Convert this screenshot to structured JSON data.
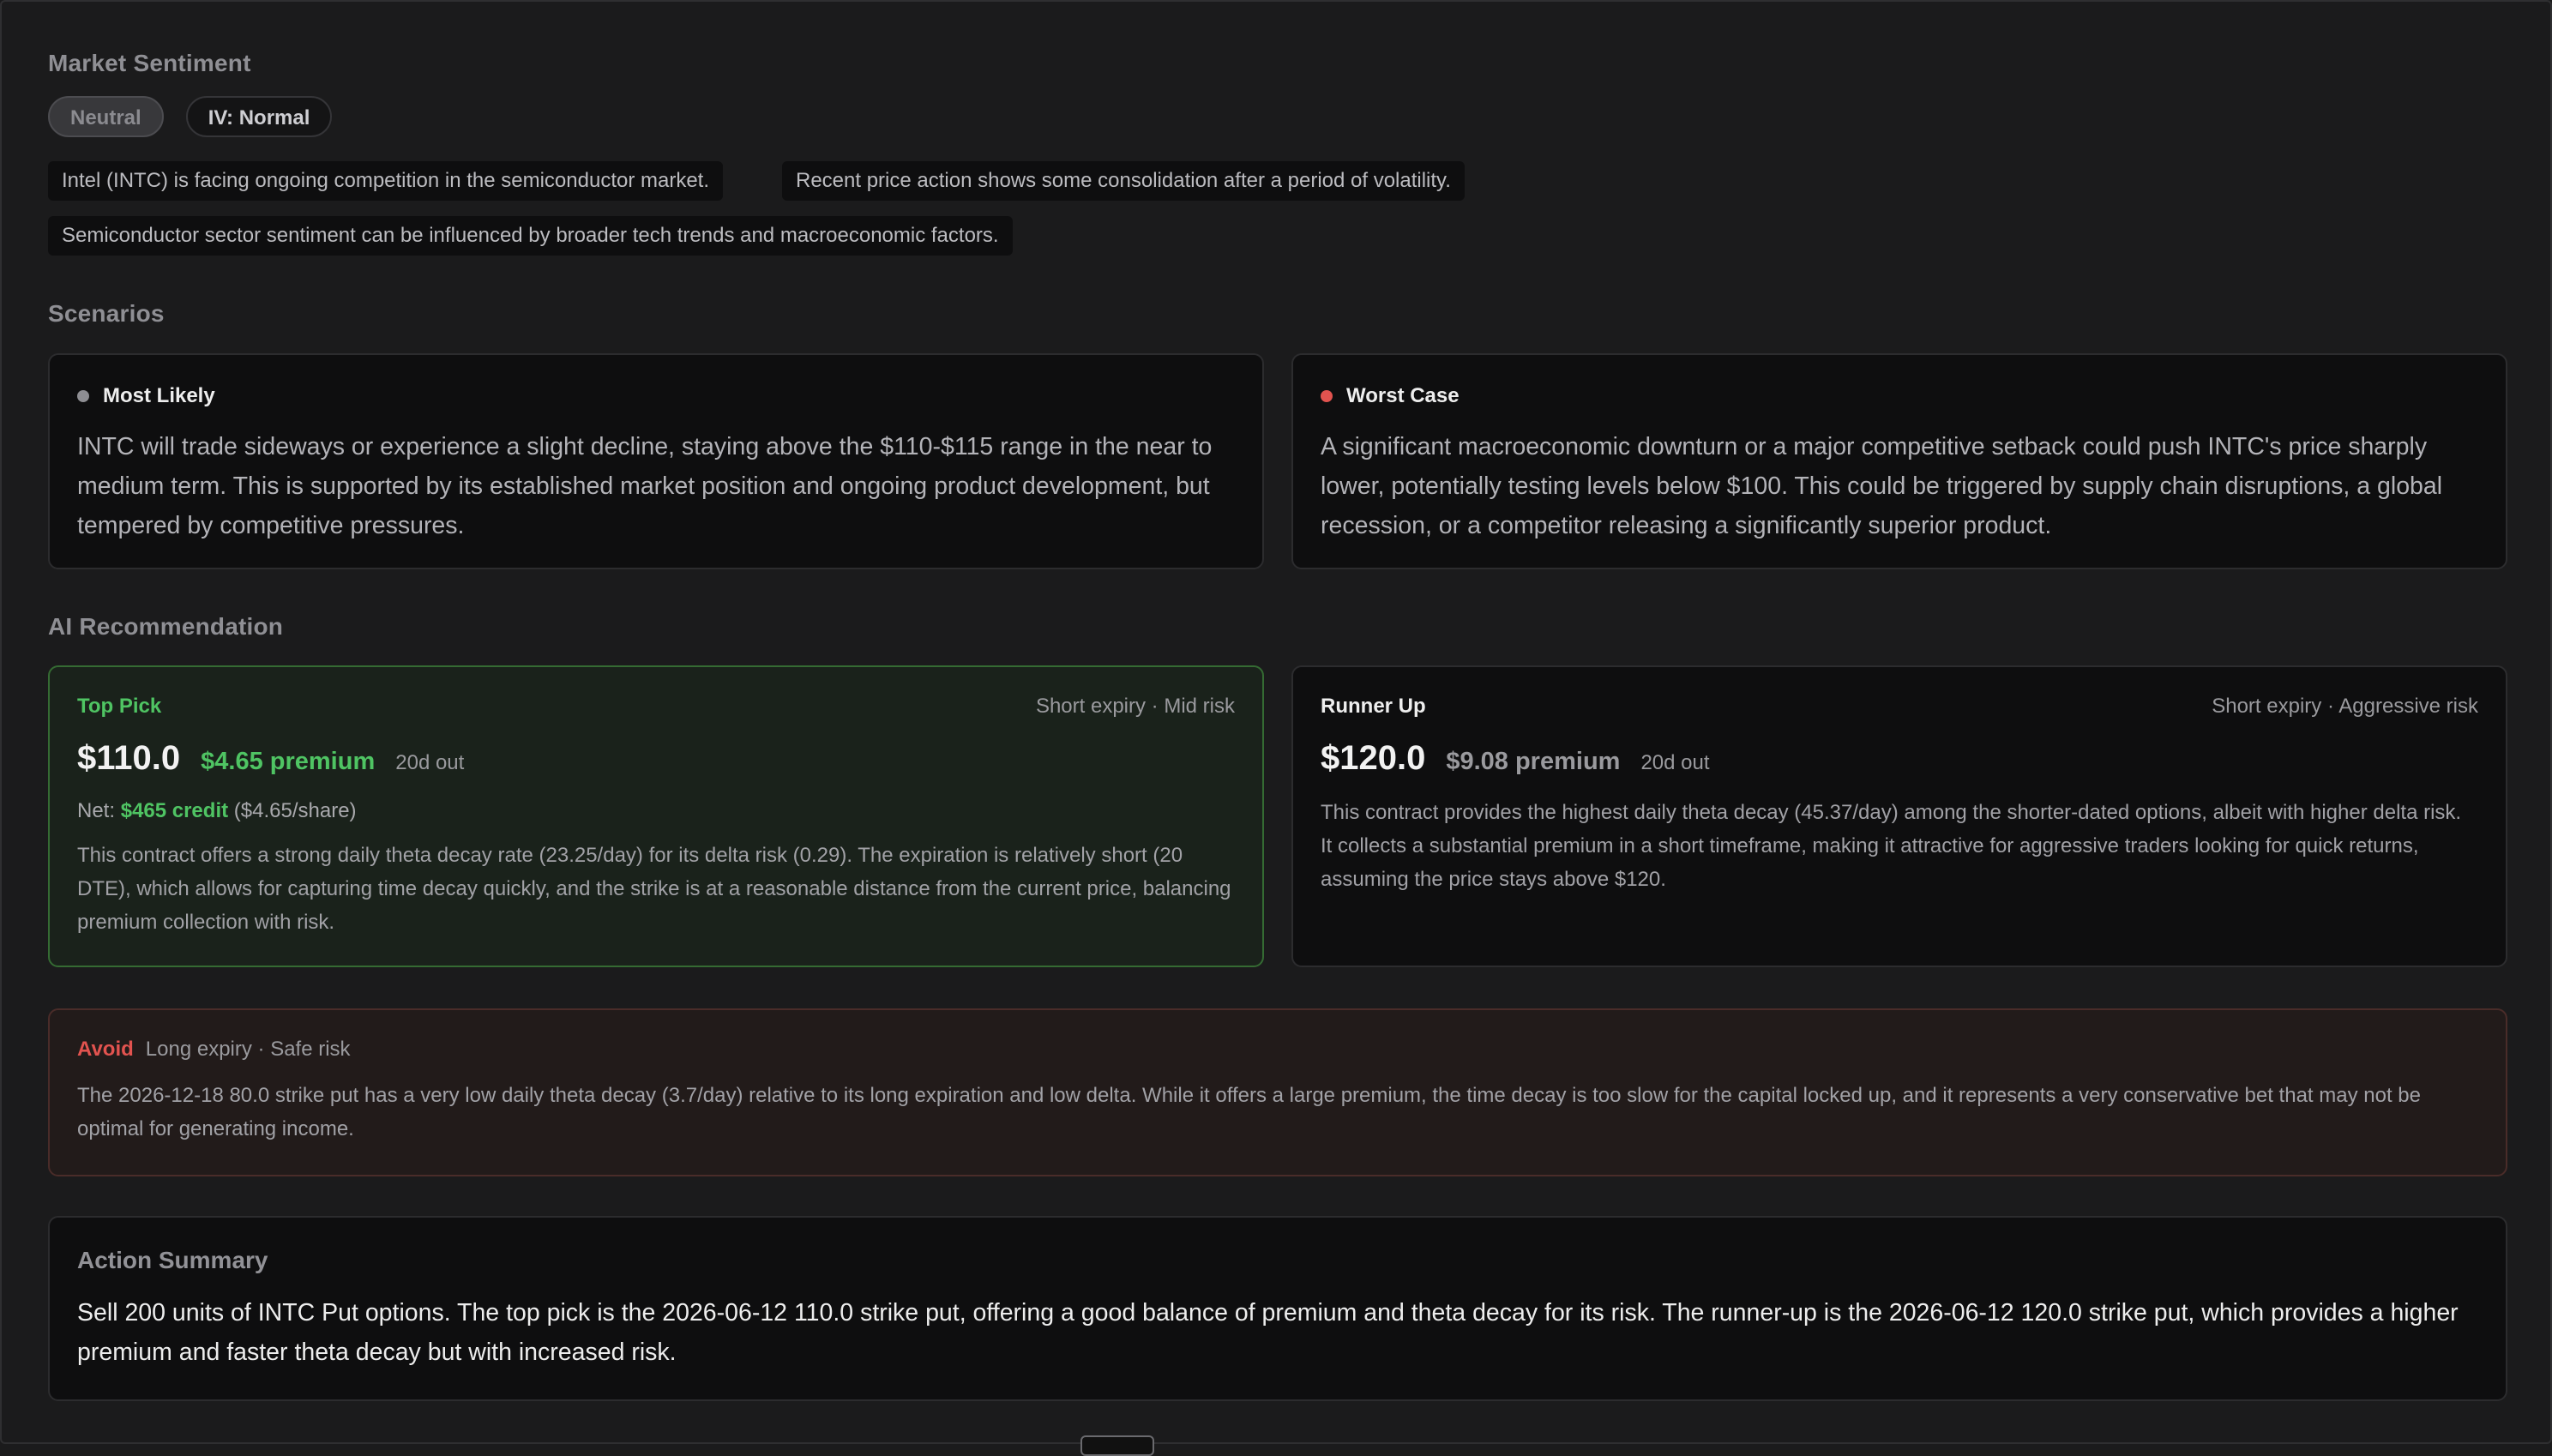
{
  "sentiment": {
    "title": "Market Sentiment",
    "badges": [
      "Neutral",
      "IV: Normal"
    ],
    "notes": [
      "Intel (INTC) is facing ongoing competition in the semiconductor market.",
      "Recent price action shows some consolidation after a period of volatility.",
      "Semiconductor sector sentiment can be influenced by broader tech trends and macroeconomic factors."
    ]
  },
  "scenarios": {
    "title": "Scenarios",
    "items": [
      {
        "label": "Most Likely",
        "dot_color": "#8e8e93",
        "text": "INTC will trade sideways or experience a slight decline, staying above the $110-$115 range in the near to medium term. This is supported by its established market position and ongoing product development, but tempered by competitive pressures."
      },
      {
        "label": "Worst Case",
        "dot_color": "#e2534f",
        "text": "A significant macroeconomic downturn or a major competitive setback could push INTC's price sharply lower, potentially testing levels below $100. This could be triggered by supply chain disruptions, a global recession, or a competitor releasing a significantly superior product."
      }
    ]
  },
  "recommendation": {
    "title": "AI Recommendation",
    "top_pick": {
      "label": "Top Pick",
      "meta": "Short expiry · Mid risk",
      "strike": "$110.0",
      "premium": "$4.65 premium",
      "days": "20d out",
      "net_prefix": "Net:",
      "net_credit": "$465 credit",
      "net_per_share": "($4.65/share)",
      "text": "This contract offers a strong daily theta decay rate (23.25/day) for its delta risk (0.29). The expiration is relatively short (20 DTE), which allows for capturing time decay quickly, and the strike is at a reasonable distance from the current price, balancing premium collection with risk."
    },
    "runner_up": {
      "label": "Runner Up",
      "meta": "Short expiry · Aggressive risk",
      "strike": "$120.0",
      "premium": "$9.08 premium",
      "days": "20d out",
      "text": "This contract provides the highest daily theta decay (45.37/day) among the shorter-dated options, albeit with higher delta risk. It collects a substantial premium in a short timeframe, making it attractive for aggressive traders looking for quick returns, assuming the price stays above $120."
    },
    "avoid": {
      "label": "Avoid",
      "meta": "Long expiry · Safe risk",
      "text": "The 2026-12-18 80.0 strike put has a very low daily theta decay (3.7/day) relative to its long expiration and low delta. While it offers a large premium, the time decay is too slow for the capital locked up, and it represents a very conservative bet that may not be optimal for generating income."
    }
  },
  "summary": {
    "title": "Action Summary",
    "text": "Sell 200 units of INTC Put options. The top pick is the 2026-06-12 110.0 strike put, offering a good balance of premium and theta decay for its risk. The runner-up is the 2026-06-12 120.0 strike put, which provides a higher premium and faster theta decay but with increased risk."
  },
  "colors": {
    "green": "#4fc463",
    "red": "#e2534f",
    "top_pick_bg": "#1a221b",
    "top_pick_border": "#356b33",
    "avoid_bg": "#221b1a",
    "avoid_border": "#4a2c29"
  }
}
